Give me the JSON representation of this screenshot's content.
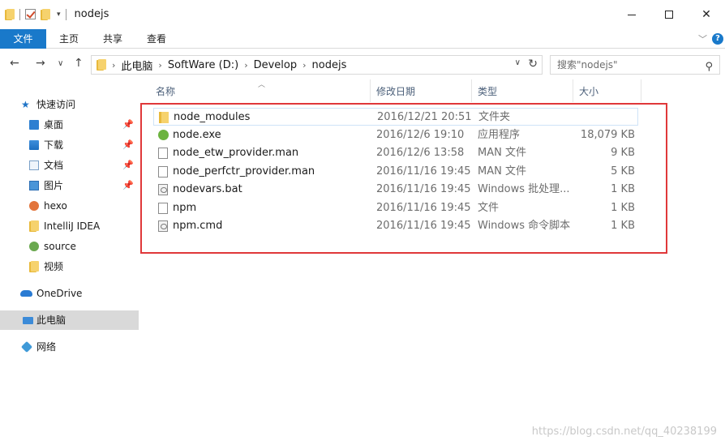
{
  "window": {
    "title": "nodejs",
    "controls": {
      "minimize": "minimize",
      "maximize": "maximize",
      "close": "✕"
    }
  },
  "ribbon": {
    "tabs": [
      {
        "label": "文件",
        "active": true
      },
      {
        "label": "主页"
      },
      {
        "label": "共享"
      },
      {
        "label": "查看"
      }
    ],
    "help": "?"
  },
  "address": {
    "crumbs": [
      "此电脑",
      "SoftWare (D:)",
      "Develop",
      "nodejs"
    ],
    "search_placeholder": "搜索\"nodejs\""
  },
  "nav": {
    "quick_access": "快速访问",
    "items": [
      {
        "label": "桌面",
        "pinned": true,
        "icon": "desktop-icon"
      },
      {
        "label": "下载",
        "pinned": true,
        "icon": "download-icon"
      },
      {
        "label": "文档",
        "pinned": true,
        "icon": "documents-icon"
      },
      {
        "label": "图片",
        "pinned": true,
        "icon": "pictures-icon"
      },
      {
        "label": "hexo",
        "icon": "hexo-icon"
      },
      {
        "label": "IntelliJ IDEA",
        "icon": "folder-icon"
      },
      {
        "label": "source",
        "icon": "source-icon"
      },
      {
        "label": "视频",
        "icon": "folder-icon"
      }
    ],
    "onedrive": "OneDrive",
    "this_pc": "此电脑",
    "network": "网络"
  },
  "columns": {
    "name": "名称",
    "modified": "修改日期",
    "type": "类型",
    "size": "大小"
  },
  "files": [
    {
      "name": "node_modules",
      "modified": "2016/12/21 20:51",
      "type": "文件夹",
      "size": "",
      "icon": "folder-icon"
    },
    {
      "name": "node.exe",
      "modified": "2016/12/6 19:10",
      "type": "应用程序",
      "size": "18,079 KB",
      "icon": "node-exe-icon"
    },
    {
      "name": "node_etw_provider.man",
      "modified": "2016/12/6 13:58",
      "type": "MAN 文件",
      "size": "9 KB",
      "icon": "file-icon"
    },
    {
      "name": "node_perfctr_provider.man",
      "modified": "2016/11/16 19:45",
      "type": "MAN 文件",
      "size": "5 KB",
      "icon": "file-icon"
    },
    {
      "name": "nodevars.bat",
      "modified": "2016/11/16 19:45",
      "type": "Windows 批处理...",
      "size": "1 KB",
      "icon": "batch-file-icon"
    },
    {
      "name": "npm",
      "modified": "2016/11/16 19:45",
      "type": "文件",
      "size": "1 KB",
      "icon": "file-icon"
    },
    {
      "name": "npm.cmd",
      "modified": "2016/11/16 19:45",
      "type": "Windows 命令脚本",
      "size": "1 KB",
      "icon": "batch-file-icon"
    }
  ],
  "watermark": "https://blog.csdn.net/qq_40238199",
  "colors": {
    "accent": "#1979ca",
    "highlight": "#e0383a",
    "selected_nav": "#d9d9d9"
  }
}
